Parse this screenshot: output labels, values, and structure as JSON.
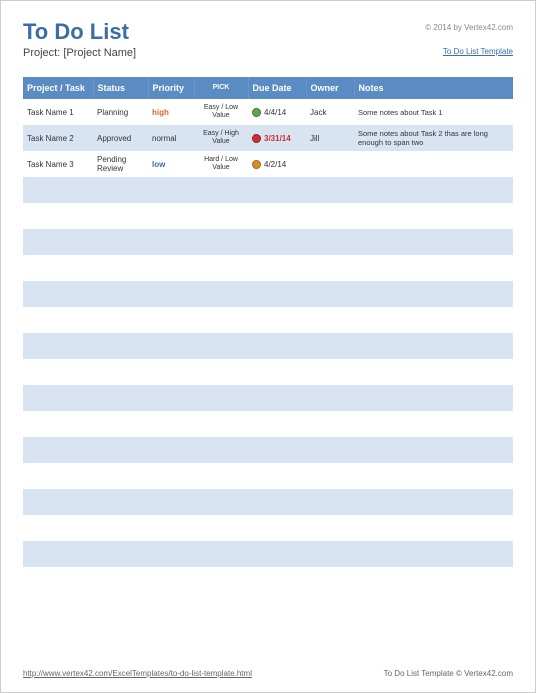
{
  "header": {
    "title": "To Do List",
    "copyright": "© 2014 by Vertex42.com",
    "project_label": "Project:",
    "project_name": "[Project Name]",
    "template_link": "To Do List Template"
  },
  "columns": {
    "task": "Project / Task",
    "status": "Status",
    "priority": "Priority",
    "pick": "PICK",
    "due": "Due Date",
    "owner": "Owner",
    "notes": "Notes"
  },
  "rows": [
    {
      "task": "Task Name 1",
      "status": "Planning",
      "priority": "high",
      "priority_class": "priority-high",
      "pick": "Easy / Low Value",
      "due": "4/4/14",
      "due_class": "",
      "dot": "dot-green",
      "owner": "Jack",
      "notes": "Some notes about Task 1"
    },
    {
      "task": "Task Name 2",
      "status": "Approved",
      "priority": "normal",
      "priority_class": "",
      "pick": "Easy / High Value",
      "due": "3/31/14",
      "due_class": "due-red",
      "dot": "dot-red",
      "owner": "Jill",
      "notes": "Some notes about Task 2 thas are long enough to span two"
    },
    {
      "task": "Task Name 3",
      "status": "Pending Review",
      "priority": "low",
      "priority_class": "priority-low",
      "pick": "Hard / Low Value",
      "due": "4/2/14",
      "due_class": "",
      "dot": "dot-orange",
      "owner": "",
      "notes": ""
    }
  ],
  "empty_rows": 15,
  "footer": {
    "url": "http://www.vertex42.com/ExcelTemplates/to-do-list-template.html",
    "credit": "To Do List Template © Vertex42.com"
  }
}
